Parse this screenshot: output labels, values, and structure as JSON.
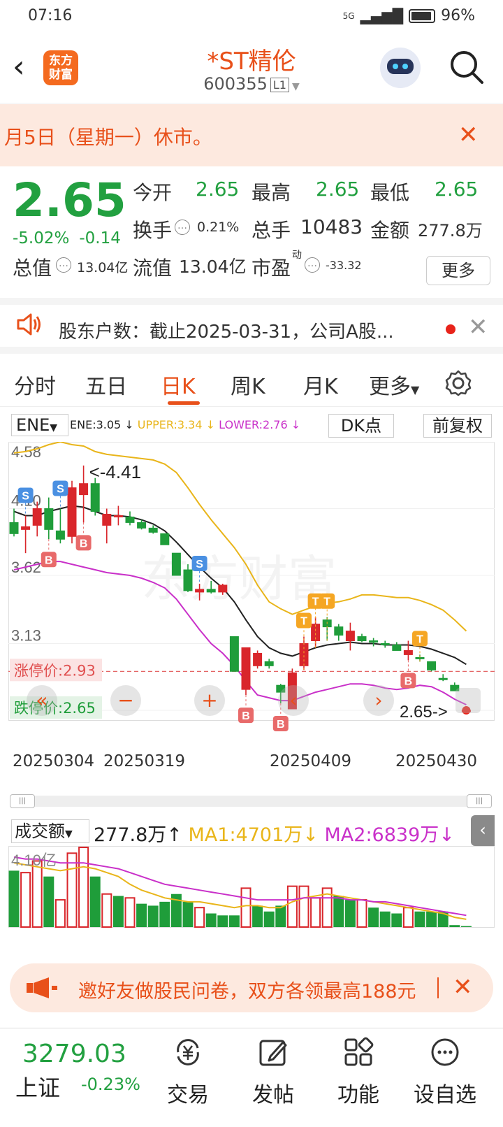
{
  "status": {
    "time": "07:16",
    "signal": "5G",
    "battery": "96%"
  },
  "header": {
    "logo_line1": "东方",
    "logo_line2": "财富",
    "title": "*ST精伦",
    "code": "600355",
    "market_badge": "L1"
  },
  "notice": {
    "text": "月5日（星期一）休市。"
  },
  "quote": {
    "price": "2.65",
    "change_pct": "-5.02%",
    "change": "-0.14",
    "open_label": "今开",
    "open": "2.65",
    "high_label": "最高",
    "high": "2.65",
    "low_label": "最低",
    "low": "2.65",
    "turnover_label": "换手",
    "turnover": "0.21%",
    "volume_label": "总手",
    "volume": "10483",
    "amount_label": "金额",
    "amount": "277.8万",
    "mktcap_label": "总值",
    "mktcap": "13.04亿",
    "float_label": "流值",
    "float_cap": "13.04亿",
    "pe_label": "市盈",
    "pe_sup": "动",
    "pe": "-33.32",
    "more": "更多"
  },
  "holder_notice": {
    "text": "股东户数：截止2025-03-31，公司A股..."
  },
  "tabs": [
    "分时",
    "五日",
    "日K",
    "周K",
    "月K",
    "更多"
  ],
  "chart_header": {
    "indicator": "ENE",
    "ene": "ENE:3.05",
    "upper": "UPPER:3.34",
    "lower": "LOWER:2.76",
    "dk_button": "DK点",
    "adjust_button": "前复权"
  },
  "kline": {
    "y_labels": [
      "4.58",
      "4.10",
      "3.62",
      "3.13",
      "2.65"
    ],
    "max_annotation": "<-4.41",
    "last_annotation": "2.65->",
    "limit_up": "涨停价:2.93",
    "limit_down": "跌停价:2.65",
    "dates": [
      "20250304",
      "20250319",
      "20250409",
      "20250430"
    ]
  },
  "chart_data": {
    "type": "candlestick",
    "ylim": [
      2.65,
      4.58
    ],
    "candles": [
      {
        "o": 4.0,
        "h": 4.1,
        "l": 3.9,
        "c": 3.92
      },
      {
        "o": 3.95,
        "h": 4.05,
        "l": 3.78,
        "c": 3.97
      },
      {
        "o": 3.98,
        "h": 4.15,
        "l": 3.9,
        "c": 4.1
      },
      {
        "o": 4.1,
        "h": 4.18,
        "l": 3.88,
        "c": 3.95
      },
      {
        "o": 3.94,
        "h": 4.1,
        "l": 3.85,
        "c": 3.88
      },
      {
        "o": 3.9,
        "h": 4.3,
        "l": 3.85,
        "c": 4.25
      },
      {
        "o": 4.2,
        "h": 4.41,
        "l": 4.0,
        "c": 4.28
      },
      {
        "o": 4.28,
        "h": 4.32,
        "l": 4.05,
        "c": 4.08
      },
      {
        "o": 3.98,
        "h": 4.1,
        "l": 3.85,
        "c": 4.06
      },
      {
        "o": 4.05,
        "h": 4.12,
        "l": 3.98,
        "c": 4.05
      },
      {
        "o": 4.04,
        "h": 4.08,
        "l": 3.98,
        "c": 4.0
      },
      {
        "o": 4.0,
        "h": 4.02,
        "l": 3.95,
        "c": 3.96
      },
      {
        "o": 3.96,
        "h": 3.98,
        "l": 3.92,
        "c": 3.93
      },
      {
        "o": 3.92,
        "h": 3.92,
        "l": 3.84,
        "c": 3.84
      },
      {
        "o": 3.78,
        "h": 3.78,
        "l": 3.62,
        "c": 3.62
      },
      {
        "o": 3.66,
        "h": 3.7,
        "l": 3.5,
        "c": 3.51
      },
      {
        "o": 3.5,
        "h": 3.56,
        "l": 3.44,
        "c": 3.52
      },
      {
        "o": 3.52,
        "h": 3.58,
        "l": 3.49,
        "c": 3.5
      },
      {
        "o": 3.5,
        "h": 3.56,
        "l": 3.48,
        "c": 3.55
      },
      {
        "o": 3.18,
        "h": 3.18,
        "l": 2.93,
        "c": 2.93
      },
      {
        "o": 2.8,
        "h": 3.05,
        "l": 2.76,
        "c": 3.1
      },
      {
        "o": 2.97,
        "h": 3.08,
        "l": 2.95,
        "c": 3.06
      },
      {
        "o": 3.0,
        "h": 3.02,
        "l": 2.95,
        "c": 2.97
      },
      {
        "o": 2.83,
        "h": 2.84,
        "l": 2.7,
        "c": 2.78
      },
      {
        "o": 2.66,
        "h": 2.95,
        "l": 2.66,
        "c": 2.92
      },
      {
        "o": 2.97,
        "h": 3.18,
        "l": 2.94,
        "c": 3.13
      },
      {
        "o": 3.15,
        "h": 3.32,
        "l": 3.1,
        "c": 3.27
      },
      {
        "o": 3.3,
        "h": 3.32,
        "l": 3.15,
        "c": 3.25
      },
      {
        "o": 3.25,
        "h": 3.27,
        "l": 3.15,
        "c": 3.19
      },
      {
        "o": 3.15,
        "h": 3.28,
        "l": 3.08,
        "c": 3.22
      },
      {
        "o": 3.18,
        "h": 3.2,
        "l": 3.14,
        "c": 3.15
      },
      {
        "o": 3.15,
        "h": 3.17,
        "l": 3.11,
        "c": 3.14
      },
      {
        "o": 3.13,
        "h": 3.15,
        "l": 3.1,
        "c": 3.12
      },
      {
        "o": 3.12,
        "h": 3.14,
        "l": 3.08,
        "c": 3.08
      },
      {
        "o": 3.05,
        "h": 3.15,
        "l": 3.01,
        "c": 3.08
      },
      {
        "o": 3.03,
        "h": 3.05,
        "l": 3.0,
        "c": 3.02
      },
      {
        "o": 3.0,
        "h": 3.0,
        "l": 2.93,
        "c": 2.94
      },
      {
        "o": 2.88,
        "h": 2.91,
        "l": 2.86,
        "c": 2.87
      },
      {
        "o": 2.83,
        "h": 2.85,
        "l": 2.79,
        "c": 2.79
      },
      {
        "o": 2.65,
        "h": 2.65,
        "l": 2.65,
        "c": 2.65
      }
    ],
    "ene": [
      4.08,
      4.05,
      4.05,
      4.08,
      4.1,
      4.12,
      4.11,
      4.08,
      4.05,
      4.05,
      4.04,
      4.02,
      3.99,
      3.94,
      3.86,
      3.77,
      3.68,
      3.6,
      3.53,
      3.43,
      3.3,
      3.18,
      3.1,
      3.06,
      3.04,
      3.07,
      3.1,
      3.12,
      3.13,
      3.14,
      3.13,
      3.13,
      3.12,
      3.12,
      3.12,
      3.11,
      3.09,
      3.06,
      3.03,
      2.98
    ],
    "upper": [
      4.5,
      4.51,
      4.53,
      4.56,
      4.58,
      4.56,
      4.55,
      4.51,
      4.49,
      4.48,
      4.47,
      4.46,
      4.45,
      4.42,
      4.36,
      4.25,
      4.13,
      4.02,
      3.92,
      3.82,
      3.7,
      3.55,
      3.43,
      3.38,
      3.34,
      3.37,
      3.4,
      3.42,
      3.43,
      3.45,
      3.48,
      3.48,
      3.47,
      3.46,
      3.46,
      3.44,
      3.41,
      3.37,
      3.3,
      3.22
    ],
    "lower": [
      3.66,
      3.68,
      3.7,
      3.72,
      3.72,
      3.7,
      3.68,
      3.66,
      3.64,
      3.63,
      3.62,
      3.6,
      3.57,
      3.53,
      3.45,
      3.34,
      3.23,
      3.13,
      3.06,
      2.97,
      2.86,
      2.76,
      2.74,
      2.72,
      2.72,
      2.75,
      2.78,
      2.8,
      2.82,
      2.84,
      2.84,
      2.83,
      2.81,
      2.8,
      2.81,
      2.83,
      2.82,
      2.78,
      2.73,
      2.69
    ],
    "signals": [
      {
        "i": 1,
        "t": "S"
      },
      {
        "i": 4,
        "t": "S"
      },
      {
        "i": 6,
        "t": "B"
      },
      {
        "i": 3,
        "t": "B"
      },
      {
        "i": 16,
        "t": "S"
      },
      {
        "i": 20,
        "t": "B"
      },
      {
        "i": 23,
        "t": "B"
      },
      {
        "i": 25,
        "t": "T"
      },
      {
        "i": 26,
        "t": "T"
      },
      {
        "i": 27,
        "t": "T"
      },
      {
        "i": 34,
        "t": "B"
      },
      {
        "i": 35,
        "t": "T"
      }
    ],
    "volume": {
      "title": "成交额",
      "current": "277.8万",
      "ma1": "MA1:4701万",
      "ma2": "MA2:6839万",
      "y_max_label": "4.10亿",
      "bars": [
        {
          "v": 2.9,
          "up": false
        },
        {
          "v": 2.8,
          "up": true
        },
        {
          "v": 3.4,
          "up": true
        },
        {
          "v": 2.6,
          "up": false
        },
        {
          "v": 1.4,
          "up": true
        },
        {
          "v": 3.8,
          "up": true
        },
        {
          "v": 4.1,
          "up": true
        },
        {
          "v": 2.6,
          "up": false
        },
        {
          "v": 1.7,
          "up": true
        },
        {
          "v": 1.6,
          "up": false
        },
        {
          "v": 1.5,
          "up": true
        },
        {
          "v": 1.2,
          "up": false
        },
        {
          "v": 1.1,
          "up": false
        },
        {
          "v": 1.3,
          "up": false
        },
        {
          "v": 1.7,
          "up": false
        },
        {
          "v": 1.3,
          "up": false
        },
        {
          "v": 1.0,
          "up": true
        },
        {
          "v": 0.7,
          "up": false
        },
        {
          "v": 0.6,
          "up": false
        },
        {
          "v": 0.6,
          "up": false
        },
        {
          "v": 2.0,
          "up": true
        },
        {
          "v": 1.1,
          "up": false
        },
        {
          "v": 0.8,
          "up": false
        },
        {
          "v": 1.1,
          "up": false
        },
        {
          "v": 2.1,
          "up": true
        },
        {
          "v": 2.1,
          "up": true
        },
        {
          "v": 1.5,
          "up": true
        },
        {
          "v": 2.0,
          "up": true
        },
        {
          "v": 1.6,
          "up": false
        },
        {
          "v": 1.4,
          "up": false
        },
        {
          "v": 1.4,
          "up": true
        },
        {
          "v": 1.0,
          "up": false
        },
        {
          "v": 0.8,
          "up": false
        },
        {
          "v": 0.7,
          "up": false
        },
        {
          "v": 1.0,
          "up": true
        },
        {
          "v": 0.8,
          "up": false
        },
        {
          "v": 0.8,
          "up": false
        },
        {
          "v": 0.8,
          "up": false
        },
        {
          "v": 0.1,
          "up": false
        },
        {
          "v": 0.05,
          "up": false
        }
      ],
      "ma1_line": [
        3.3,
        3.2,
        3.1,
        3.0,
        2.9,
        3.0,
        3.1,
        3.0,
        2.8,
        2.6,
        2.2,
        1.9,
        1.7,
        1.5,
        1.4,
        1.3,
        1.3,
        1.2,
        1.1,
        1.0,
        1.1,
        1.1,
        1.0,
        1.0,
        1.3,
        1.5,
        1.6,
        1.7,
        1.6,
        1.5,
        1.4,
        1.3,
        1.2,
        1.1,
        1.0,
        0.9,
        0.8,
        0.7,
        0.5,
        0.4
      ],
      "ma2_line": [
        3.6,
        3.5,
        3.5,
        3.4,
        3.3,
        3.3,
        3.3,
        3.2,
        3.1,
        3.0,
        2.8,
        2.6,
        2.4,
        2.2,
        2.1,
        2.0,
        1.9,
        1.8,
        1.7,
        1.6,
        1.5,
        1.4,
        1.4,
        1.4,
        1.4,
        1.5,
        1.5,
        1.5,
        1.5,
        1.4,
        1.4,
        1.3,
        1.3,
        1.2,
        1.1,
        1.0,
        0.9,
        0.8,
        0.7,
        0.6
      ],
      "ylim": [
        0,
        4.1
      ]
    },
    "colors": {
      "up": "#d9262b",
      "down": "#1f9d3a",
      "ene": "#222222",
      "upper": "#e9b51a",
      "lower": "#c930c9"
    }
  },
  "survey": {
    "text": "邀好友做股民问卷，双方各领最高188元"
  },
  "bottom": {
    "index_value": "3279.03",
    "index_name": "上证",
    "index_change": "-0.23%",
    "nav": [
      "交易",
      "发帖",
      "功能",
      "设自选"
    ]
  }
}
